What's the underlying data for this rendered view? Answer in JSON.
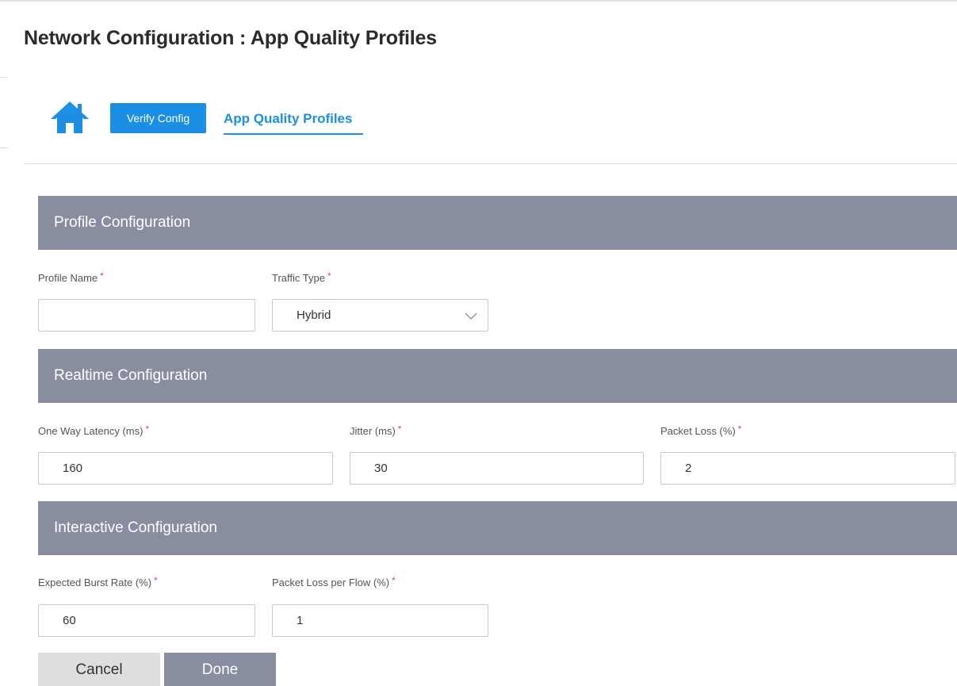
{
  "page": {
    "title": "Network Configuration : App Quality Profiles"
  },
  "nav": {
    "home_icon": "home-icon",
    "verify_config_label": "Verify Config",
    "active_tab_label": "App Quality Profiles"
  },
  "sections": {
    "profile": {
      "title": "Profile Configuration",
      "profile_name_label": "Profile Name",
      "profile_name_value": "",
      "traffic_type_label": "Traffic Type",
      "traffic_type_value": "Hybrid"
    },
    "realtime": {
      "title": "Realtime Configuration",
      "latency_label": "One Way Latency (ms)",
      "latency_value": "160",
      "jitter_label": "Jitter (ms)",
      "jitter_value": "30",
      "packet_loss_label": "Packet Loss (%)",
      "packet_loss_value": "2"
    },
    "interactive": {
      "title": "Interactive Configuration",
      "burst_rate_label": "Expected Burst Rate (%)",
      "burst_rate_value": "60",
      "packet_loss_flow_label": "Packet Loss per Flow (%)",
      "packet_loss_flow_value": "1"
    }
  },
  "required_marker": "*",
  "actions": {
    "cancel_label": "Cancel",
    "done_label": "Done"
  },
  "colors": {
    "accent": "#1a8fe3",
    "section_header": "#888ea0",
    "required": "#e74c3c"
  }
}
